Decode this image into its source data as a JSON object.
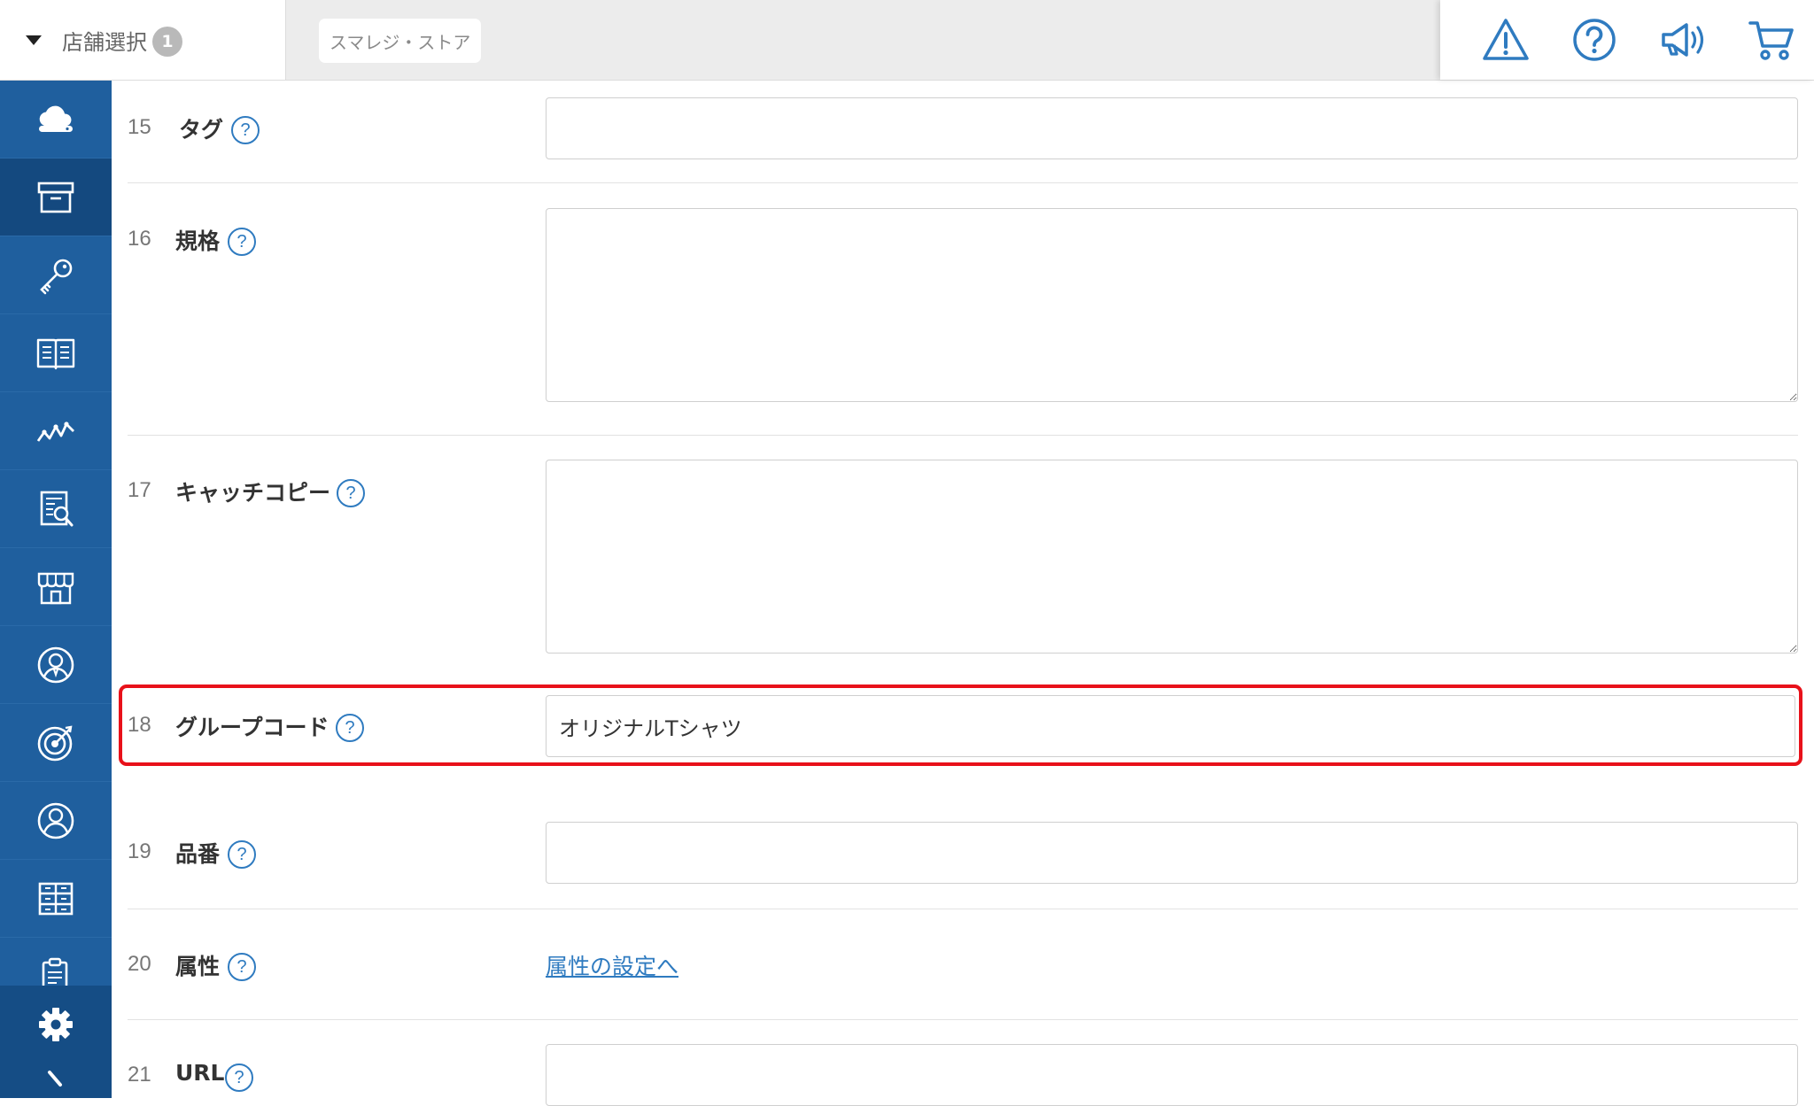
{
  "header": {
    "store_select_label": "店舗選択",
    "store_count": "1",
    "current_store": "スマレジ・ストア",
    "icons": [
      "warning-icon",
      "help-icon",
      "announcement-icon",
      "cart-icon"
    ],
    "accent_color": "#2f7bc0"
  },
  "sidebar": {
    "background_color": "#1f5f9e",
    "items": [
      {
        "icon": "cloud-icon"
      },
      {
        "icon": "archive-box-icon",
        "active": true
      },
      {
        "icon": "key-icon"
      },
      {
        "icon": "book-icon"
      },
      {
        "icon": "trend-chart-icon"
      },
      {
        "icon": "report-search-icon"
      },
      {
        "icon": "store-icon"
      },
      {
        "icon": "staff-icon"
      },
      {
        "icon": "target-icon"
      },
      {
        "icon": "customer-icon"
      },
      {
        "icon": "grid-icon"
      },
      {
        "icon": "clipboard-icon"
      }
    ],
    "bottom_items": [
      {
        "icon": "gear-icon"
      },
      {
        "icon": "chevron-right-icon"
      }
    ]
  },
  "form": {
    "help_mark": "?",
    "rows": [
      {
        "number": "15",
        "label": "タグ",
        "type": "input",
        "value": ""
      },
      {
        "number": "16",
        "label": "規格",
        "type": "textarea",
        "value": ""
      },
      {
        "number": "17",
        "label": "キャッチコピー",
        "type": "textarea",
        "value": ""
      },
      {
        "number": "18",
        "label": "グループコード",
        "type": "input",
        "value": "オリジナルTシャツ",
        "highlighted": true
      },
      {
        "number": "19",
        "label": "品番",
        "type": "input",
        "value": ""
      },
      {
        "number": "20",
        "label": "属性",
        "type": "link",
        "link_text": "属性の設定へ"
      },
      {
        "number": "21",
        "label": "URL",
        "type": "input",
        "value": ""
      }
    ],
    "highlight_color": "#e8111a"
  }
}
